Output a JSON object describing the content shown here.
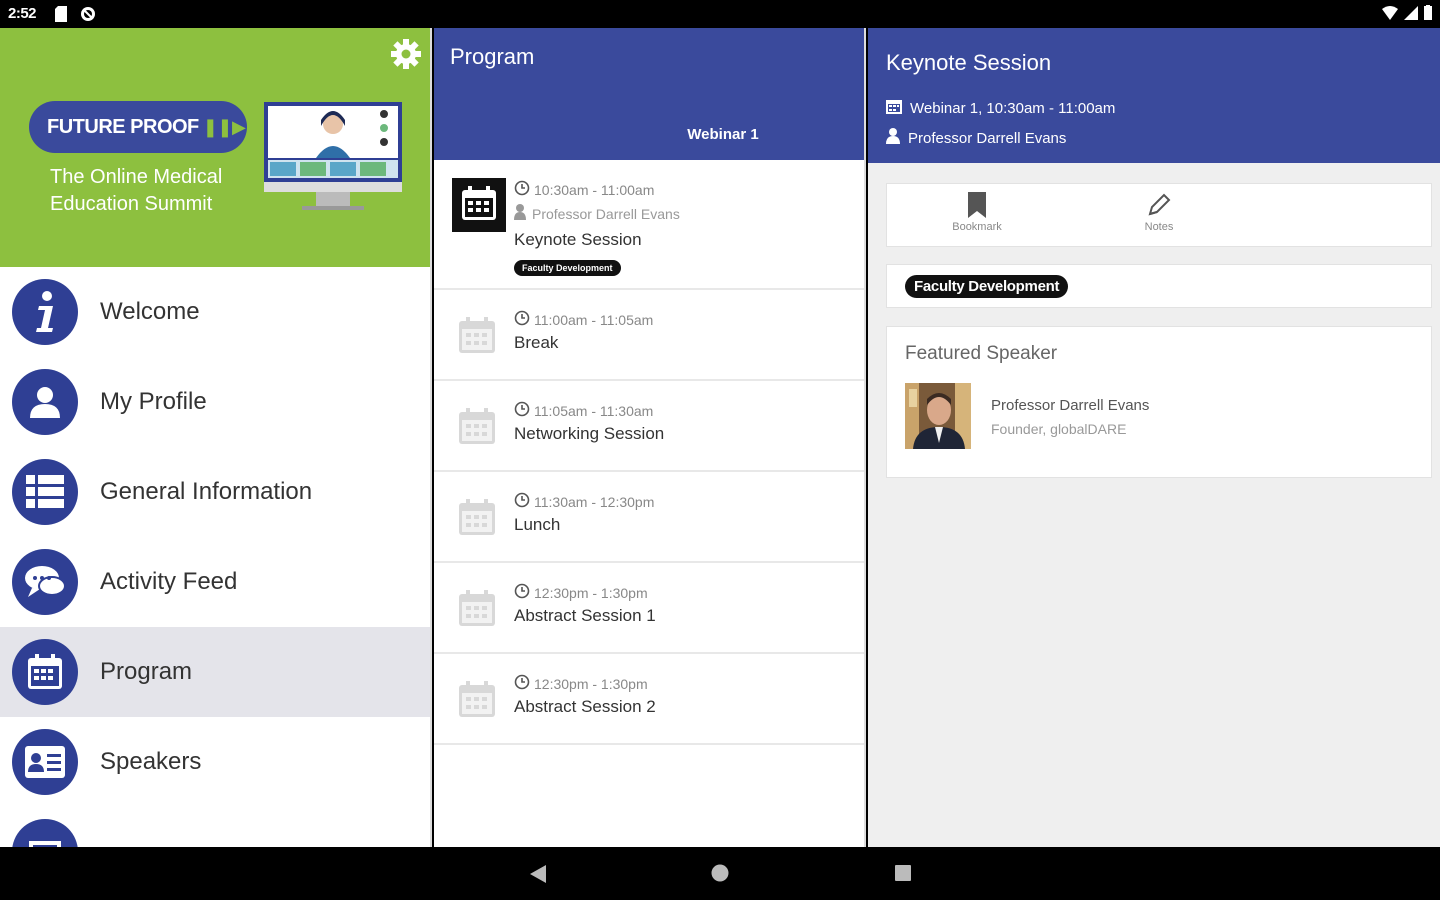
{
  "status_bar": {
    "time": "2:52"
  },
  "drawer": {
    "banner": {
      "logo_text": "FUTURE PROOF",
      "tagline_line1": "The Online Medical",
      "tagline_line2": "Education Summit"
    },
    "items": [
      {
        "label": "Welcome",
        "icon": "info-icon"
      },
      {
        "label": "My Profile",
        "icon": "person-icon"
      },
      {
        "label": "General Information",
        "icon": "list-icon"
      },
      {
        "label": "Activity Feed",
        "icon": "chat-icon"
      },
      {
        "label": "Program",
        "icon": "calendar-icon",
        "active": true
      },
      {
        "label": "Speakers",
        "icon": "id-card-icon"
      }
    ]
  },
  "program": {
    "title": "Program",
    "tab": "Webinar 1",
    "sessions": [
      {
        "time": "10:30am - 11:00am",
        "speaker": "Professor Darrell Evans",
        "title": "Keynote Session",
        "tag": "Faculty Development"
      },
      {
        "time": "11:00am - 11:05am",
        "title": "Break"
      },
      {
        "time": "11:05am - 11:30am",
        "title": "Networking Session"
      },
      {
        "time": "11:30am - 12:30pm",
        "title": "Lunch"
      },
      {
        "time": "12:30pm - 1:30pm",
        "title": "Abstract Session 1"
      },
      {
        "time": "12:30pm - 1:30pm",
        "title": "Abstract Session 2"
      }
    ]
  },
  "detail": {
    "title": "Keynote Session",
    "when": "Webinar 1, 10:30am - 11:00am",
    "speaker": "Professor Darrell Evans",
    "actions": {
      "bookmark": "Bookmark",
      "notes": "Notes"
    },
    "tag": "Faculty Development",
    "featured_heading": "Featured Speaker",
    "featured_name": "Professor Darrell Evans",
    "featured_role": "Founder, globalDARE"
  },
  "colors": {
    "brand_blue": "#3a4a9c",
    "brand_green": "#8dc03f"
  }
}
